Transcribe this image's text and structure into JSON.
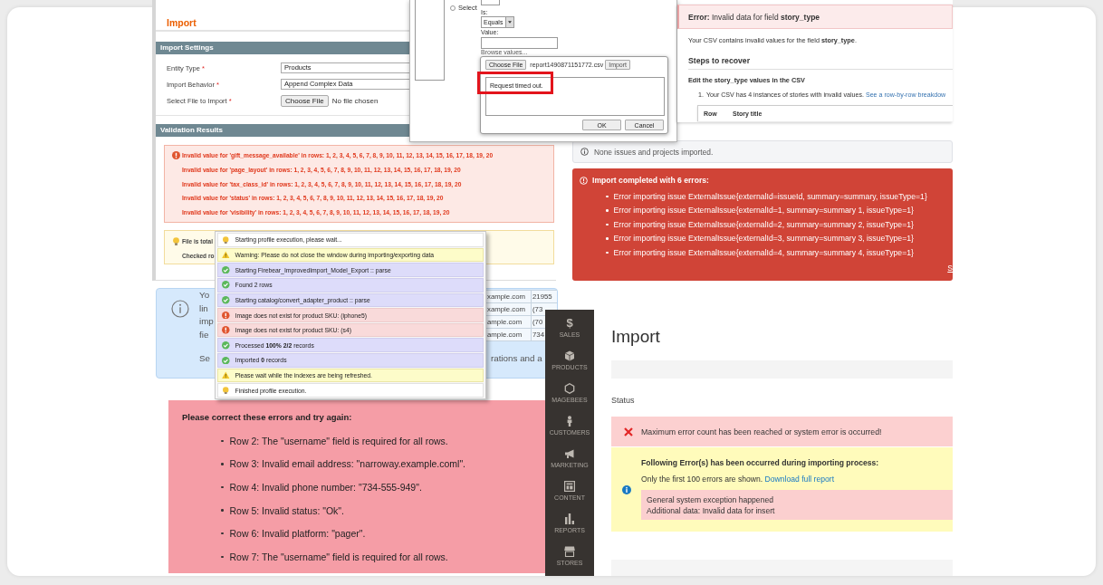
{
  "legacy_import": {
    "title": "Import",
    "settings_header": "Import Settings",
    "fields": [
      {
        "kind": "select",
        "label": "Entity Type",
        "required_mark": "*",
        "value": "Products"
      },
      {
        "kind": "select",
        "label": "Import Behavior",
        "required_mark": "*",
        "value": "Append Complex Data"
      },
      {
        "kind": "file",
        "label": "Select File to Import",
        "required_mark": "*",
        "button": "Choose File",
        "value": "No file chosen"
      }
    ],
    "validation_header": "Validation Results",
    "errors": [
      "Invalid value for 'gift_message_available' in rows: 1, 2, 3, 4, 5, 6, 7, 8, 9, 10, 11, 12, 13, 14, 15, 16, 17, 18, 19, 20",
      "Invalid value for 'page_layout' in rows: 1, 2, 3, 4, 5, 6, 7, 8, 9, 10, 11, 12, 13, 14, 15, 16, 17, 18, 19, 20",
      "Invalid value for 'tax_class_id' in rows: 1, 2, 3, 4, 5, 6, 7, 8, 9, 10, 11, 12, 13, 14, 15, 16, 17, 18, 19, 20",
      "Invalid value for 'status' in rows: 1, 2, 3, 4, 5, 6, 7, 8, 9, 10, 11, 12, 13, 14, 15, 16, 17, 18, 19, 20",
      "Invalid value for 'visibility' in rows: 1, 2, 3, 4, 5, 6, 7, 8, 9, 10, 11, 12, 13, 14, 15, 16, 17, 18, 19, 20"
    ],
    "notices": [
      "File is total",
      "Checked ro"
    ]
  },
  "filter_dialog": {
    "option": {
      "label": "Select",
      "selected": false
    },
    "operator_label": "Is:",
    "operator": "Equals",
    "value_label": "Value:",
    "browse_link": "Browse values...",
    "upload": {
      "choose_button": "Choose File",
      "file_name": "report1490871151772.csv",
      "import_button": "Import",
      "message": "Request timed out.",
      "message_highlighted": true,
      "buttons": [
        "OK",
        "Cancel"
      ]
    }
  },
  "story_error": {
    "title": "**Error:** Invalid data for field **story_type**",
    "description": "Your CSV contains invalid values for the field **story_type**.",
    "steps_heading": "Steps to recover",
    "step_heading": "Edit the story_type values in the CSV",
    "steps": [
      {
        "number": "1.",
        "text": "Your CSV has 4 instances of stories with invalid values.",
        "link": "See a row-by-row breakdow"
      }
    ],
    "table_columns": [
      "Row",
      "Story title"
    ]
  },
  "issue_import": {
    "info": "None issues and projects imported.",
    "error_title": "Import completed with 6 errors:",
    "errors": [
      "Error importing issue ExternalIssue{externalId=issueId, summary=summary, issueType=1}",
      "Error importing issue ExternalIssue{externalId=1, summary=summary 1, issueType=1}",
      "Error importing issue ExternalIssue{externalId=2, summary=summary 2, issueType=1}",
      "Error importing issue ExternalIssue{externalId=3, summary=summary 3, issueType=1}",
      "Error importing issue ExternalIssue{externalId=4, summary=summary 4, issueType=1}"
    ],
    "more_link": "S"
  },
  "help_notice": {
    "fragments": [
      "Yo",
      "lin",
      "imp",
      "fie"
    ],
    "last_fragment": "Se",
    "table_rows": [
      [
        "xample.com",
        "21955"
      ],
      [
        "xample.com",
        "(73"
      ],
      [
        "ample.com",
        "(70"
      ],
      [
        "ample.com",
        "734"
      ]
    ],
    "trailing_fragment": "rations and a"
  },
  "process_log": [
    {
      "kind": "info",
      "text": "Starting profile execution, please wait..."
    },
    {
      "kind": "warning",
      "text": "Warning: Please do not close the window during importing/exporting data"
    },
    {
      "kind": "success",
      "text": "Starting Firebear_ImprovedImport_Model_Export :: parse"
    },
    {
      "kind": "success",
      "text": "Found 2 rows"
    },
    {
      "kind": "success",
      "text": "Starting catalog/convert_adapter_product :: parse"
    },
    {
      "kind": "error",
      "text": "Image does not exist for product SKU: (iphone5)"
    },
    {
      "kind": "error",
      "text": "Image does not exist for product SKU: (s4)"
    },
    {
      "kind": "success",
      "text": "Processed **100% 2/2** records"
    },
    {
      "kind": "success",
      "text": "Imported **0** records"
    },
    {
      "kind": "warning",
      "text": "Please wait while the indexes are being refreshed."
    },
    {
      "kind": "info",
      "text": "Finished profile execution."
    }
  ],
  "form_errors": {
    "heading": "Please correct these errors and try again:",
    "items": [
      "Row 2: The \"username\" field is required for all rows.",
      "Row 3: Invalid email address: \"narroway.example.coml\".",
      "Row 4: Invalid phone number: \"734-555-949\".",
      "Row 5: Invalid status: \"Ok\".",
      "Row 6: Invalid platform: \"pager\".",
      "Row 7: The \"username\" field is required for all rows."
    ]
  },
  "magento_import": {
    "menu": [
      {
        "glyph": "$",
        "label": "SALES"
      },
      {
        "label": "PRODUCTS"
      },
      {
        "label": "MAGEBEES"
      },
      {
        "label": "CUSTOMERS"
      },
      {
        "label": "MARKETING"
      },
      {
        "label": "CONTENT"
      },
      {
        "label": "REPORTS"
      },
      {
        "label": "STORES"
      }
    ],
    "title": "Import",
    "status_label": "Status",
    "messages": [
      {
        "kind": "error",
        "text": "Maximum error count has been reached or system error is occurred!"
      }
    ],
    "details": {
      "heading": "Following Error(s) has been occurred during importing process:",
      "note": "Only the first 100 errors are shown.",
      "link": "Download full report",
      "exception_lines": [
        "General system exception happened",
        "Additional data: Invalid data for insert"
      ]
    }
  }
}
